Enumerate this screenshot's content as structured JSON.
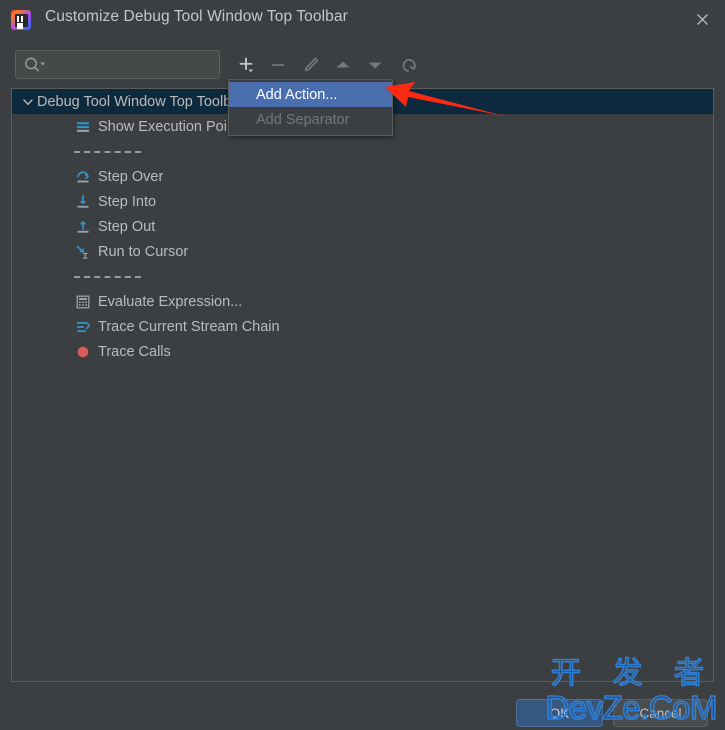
{
  "window": {
    "title": "Customize Debug Tool Window Top Toolbar",
    "app_icon": "intellij-idea-icon",
    "close_icon": "close-icon"
  },
  "toolbar": {
    "search": {
      "icon": "search-icon",
      "value": "",
      "placeholder": ""
    },
    "buttons": [
      {
        "name": "add-button",
        "icon": "plus-icon",
        "label": "Add",
        "enabled": true
      },
      {
        "name": "remove-button",
        "icon": "minus-icon",
        "label": "Remove",
        "enabled": false
      },
      {
        "name": "edit-button",
        "icon": "pencil-icon",
        "label": "Edit",
        "enabled": false
      },
      {
        "name": "move-up-button",
        "icon": "arrow-up-icon",
        "label": "Move Up",
        "enabled": false
      },
      {
        "name": "move-down-button",
        "icon": "arrow-down-icon",
        "label": "Move Down",
        "enabled": false
      },
      {
        "name": "reset-button",
        "icon": "restore-icon",
        "label": "Restore Defaults",
        "enabled": false
      }
    ]
  },
  "popup_menu": {
    "items": [
      {
        "label": "Add Action...",
        "state": "selected"
      },
      {
        "label": "Add Separator",
        "state": "disabled"
      }
    ]
  },
  "tree": {
    "root": {
      "label": "Debug Tool Window Top Toolbar",
      "chevron": "chevron-down-icon",
      "selected": true
    },
    "items": [
      {
        "type": "action",
        "label": "Show Execution Point",
        "icon": "show-execution-point-icon"
      },
      {
        "type": "separator",
        "label": ""
      },
      {
        "type": "action",
        "label": "Step Over",
        "icon": "step-over-icon"
      },
      {
        "type": "action",
        "label": "Step Into",
        "icon": "step-into-icon"
      },
      {
        "type": "action",
        "label": "Step Out",
        "icon": "step-out-icon"
      },
      {
        "type": "action",
        "label": "Run to Cursor",
        "icon": "run-to-cursor-icon"
      },
      {
        "type": "separator",
        "label": ""
      },
      {
        "type": "action",
        "label": "Evaluate Expression...",
        "icon": "evaluate-expression-icon"
      },
      {
        "type": "action",
        "label": "Trace Current Stream Chain",
        "icon": "trace-stream-chain-icon"
      },
      {
        "type": "action",
        "label": "Trace Calls",
        "icon": "trace-calls-icon"
      }
    ]
  },
  "footer": {
    "ok_label": "OK",
    "cancel_label": "Cancel"
  },
  "annotation": {
    "arrow": "red-arrow-pointing-left"
  },
  "watermark": {
    "line1": "开 发 者",
    "line2": "DevZe.CoM"
  },
  "colors": {
    "window_bg": "#3c3f41",
    "selection_blue": "#4b6eaf",
    "tree_selection": "#0d293e",
    "icon_blue": "#40b6e0",
    "accent_button": "#365880",
    "annotation_red": "#ff2a12",
    "watermark_blue": "#2f7fd6"
  }
}
